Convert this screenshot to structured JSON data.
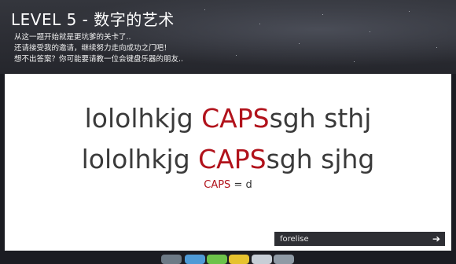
{
  "title": "LEVEL 5 - 数字的艺术",
  "intro_lines": [
    "从这一题开始就是更坑爹的关卡了..",
    "还请接受我的邀请，继续努力走向成功之门吧！",
    "想不出答案？你可能要请教一位会键盘乐器的朋友.."
  ],
  "puzzle": {
    "line1": {
      "prefix": "lololhkjg ",
      "highlight": "CAPS",
      "suffix": "sgh sthj"
    },
    "line2": {
      "prefix": "lololhkjg ",
      "highlight": "CAPS",
      "suffix": "sgh sjhg"
    },
    "hint": {
      "highlight": "CAPS",
      "suffix": " = d"
    }
  },
  "answer": {
    "value": "forelise",
    "submit_icon": "arrow-right-icon"
  },
  "colors": {
    "highlight": "#b1121b",
    "answer_bar": "#2e2f34"
  }
}
